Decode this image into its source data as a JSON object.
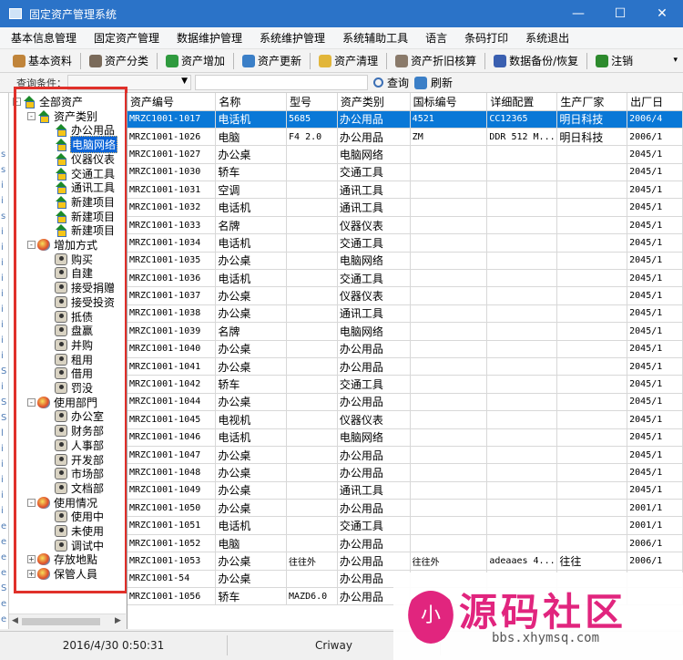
{
  "window": {
    "title": "固定资产管理系统",
    "minimize": "—",
    "maximize": "☐",
    "close": "✕"
  },
  "menu": [
    "基本信息管理",
    "固定资产管理",
    "数据维护管理",
    "系统维护管理",
    "系统辅助工具",
    "语言",
    "条码打印",
    "系统退出"
  ],
  "toolbar": [
    {
      "label": "基本资料",
      "icon": "wrench-icon",
      "color": "#c0843a"
    },
    {
      "label": "资产分类",
      "icon": "people-icon",
      "color": "#7a6a5a"
    },
    {
      "label": "资产增加",
      "icon": "add-icon",
      "color": "#2f9a3e"
    },
    {
      "label": "资产更新",
      "icon": "refresh-icon",
      "color": "#3b7fc7"
    },
    {
      "label": "资产清理",
      "icon": "clean-icon",
      "color": "#e2b63a"
    },
    {
      "label": "资产折旧核算",
      "icon": "calc-icon",
      "color": "#8a7a6a"
    },
    {
      "label": "数据备份/恢复",
      "icon": "database-icon",
      "color": "#3a5fb0"
    },
    {
      "label": "注销",
      "icon": "logout-icon",
      "color": "#2d8a2d"
    }
  ],
  "query": {
    "label": "查询条件：",
    "search_label": "查询",
    "refresh_label": "刷新"
  },
  "tree": {
    "root": "全部资产",
    "groups": [
      {
        "label": "资产类别",
        "icon": "house",
        "items": [
          "办公用品",
          "电脑网络",
          "仪器仪表",
          "交通工具",
          "通讯工具",
          "新建项目",
          "新建项目",
          "新建项目"
        ],
        "selected": 1
      },
      {
        "label": "增加方式",
        "icon": "apple",
        "items": [
          "购买",
          "自建",
          "接受捐赠",
          "接受投资",
          "抵债",
          "盘赢",
          "并购",
          "租用",
          "借用",
          "罚没"
        ]
      },
      {
        "label": "使用部門",
        "icon": "apple",
        "items": [
          "办公室",
          "财务部",
          "人事部",
          "开发部",
          "市场部",
          "文档部"
        ]
      },
      {
        "label": "使用情况",
        "icon": "apple",
        "items": [
          "使用中",
          "未使用",
          "调试中"
        ]
      },
      {
        "label": "存放地點",
        "icon": "apple",
        "collapsed": true,
        "items": []
      },
      {
        "label": "保管人員",
        "icon": "apple",
        "collapsed": true,
        "items": []
      }
    ]
  },
  "edge_letters": [
    "s",
    "s",
    "i",
    "i",
    "s",
    "i",
    "i",
    "i",
    "i",
    "i",
    "i",
    "i",
    "i",
    "i",
    "S",
    "i",
    "S",
    "S",
    "l",
    "i",
    "i",
    "i",
    "i",
    "i",
    "e",
    "e",
    "e",
    "e",
    "S",
    "e",
    "e",
    "e",
    "e"
  ],
  "grid": {
    "columns": [
      "资产编号",
      "名称",
      "型号",
      "资产类别",
      "国标编号",
      "详细配置",
      "生产厂家",
      "出厂日"
    ],
    "rows": [
      [
        "MRZC1001-1017",
        "电话机",
        "5685",
        "办公用品",
        "4521",
        "CC12365",
        "明日科技",
        "2006/4"
      ],
      [
        "MRZC1001-1026",
        "电脑",
        "F4 2.0",
        "办公用品",
        "ZM",
        "DDR 512 M...",
        "明日科技",
        "2006/1"
      ],
      [
        "MRZC1001-1027",
        "办公桌",
        "",
        "电脑网络",
        "",
        "",
        "",
        "2045/1"
      ],
      [
        "MRZC1001-1030",
        "轿车",
        "",
        "交通工具",
        "",
        "",
        "",
        "2045/1"
      ],
      [
        "MRZC1001-1031",
        "空调",
        "",
        "通讯工具",
        "",
        "",
        "",
        "2045/1"
      ],
      [
        "MRZC1001-1032",
        "电话机",
        "",
        "通讯工具",
        "",
        "",
        "",
        "2045/1"
      ],
      [
        "MRZC1001-1033",
        "名牌",
        "",
        "仪器仪表",
        "",
        "",
        "",
        "2045/1"
      ],
      [
        "MRZC1001-1034",
        "电话机",
        "",
        "交通工具",
        "",
        "",
        "",
        "2045/1"
      ],
      [
        "MRZC1001-1035",
        "办公桌",
        "",
        "电脑网络",
        "",
        "",
        "",
        "2045/1"
      ],
      [
        "MRZC1001-1036",
        "电话机",
        "",
        "交通工具",
        "",
        "",
        "",
        "2045/1"
      ],
      [
        "MRZC1001-1037",
        "办公桌",
        "",
        "仪器仪表",
        "",
        "",
        "",
        "2045/1"
      ],
      [
        "MRZC1001-1038",
        "办公桌",
        "",
        "通讯工具",
        "",
        "",
        "",
        "2045/1"
      ],
      [
        "MRZC1001-1039",
        "名牌",
        "",
        "电脑网络",
        "",
        "",
        "",
        "2045/1"
      ],
      [
        "MRZC1001-1040",
        "办公桌",
        "",
        "办公用品",
        "",
        "",
        "",
        "2045/1"
      ],
      [
        "MRZC1001-1041",
        "办公桌",
        "",
        "办公用品",
        "",
        "",
        "",
        "2045/1"
      ],
      [
        "MRZC1001-1042",
        "轿车",
        "",
        "交通工具",
        "",
        "",
        "",
        "2045/1"
      ],
      [
        "MRZC1001-1044",
        "办公桌",
        "",
        "办公用品",
        "",
        "",
        "",
        "2045/1"
      ],
      [
        "MRZC1001-1045",
        "电视机",
        "",
        "仪器仪表",
        "",
        "",
        "",
        "2045/1"
      ],
      [
        "MRZC1001-1046",
        "电话机",
        "",
        "电脑网络",
        "",
        "",
        "",
        "2045/1"
      ],
      [
        "MRZC1001-1047",
        "办公桌",
        "",
        "办公用品",
        "",
        "",
        "",
        "2045/1"
      ],
      [
        "MRZC1001-1048",
        "办公桌",
        "",
        "办公用品",
        "",
        "",
        "",
        "2045/1"
      ],
      [
        "MRZC1001-1049",
        "办公桌",
        "",
        "通讯工具",
        "",
        "",
        "",
        "2045/1"
      ],
      [
        "MRZC1001-1050",
        "办公桌",
        "",
        "办公用品",
        "",
        "",
        "",
        "2001/1"
      ],
      [
        "MRZC1001-1051",
        "电话机",
        "",
        "交通工具",
        "",
        "",
        "",
        "2001/1"
      ],
      [
        "MRZC1001-1052",
        "电脑",
        "",
        "办公用品",
        "",
        "",
        "",
        "2006/1"
      ],
      [
        "MRZC1001-1053",
        "办公桌",
        "往往外",
        "办公用品",
        "往往外",
        "adeaaes 4...",
        "往往",
        "2006/1"
      ],
      [
        "MRZC1001-54",
        "办公桌",
        "",
        "办公用品",
        "",
        "",
        "",
        ""
      ],
      [
        "MRZC1001-1056",
        "轿车",
        "MAZD6.0",
        "办公用品",
        "",
        "",
        "",
        ""
      ]
    ],
    "selected_row": 0
  },
  "status": {
    "datetime": "2016/4/30 0:50:31",
    "user": "Criway"
  },
  "watermark": {
    "text": "源码社区",
    "url": "bbs.xhymsq.com",
    "logo_text": "小",
    "color": "#e1257e"
  },
  "colors": {
    "titlebar": "#2b73c8",
    "selection": "#0a78d7",
    "highlight_box": "#e0302a"
  }
}
